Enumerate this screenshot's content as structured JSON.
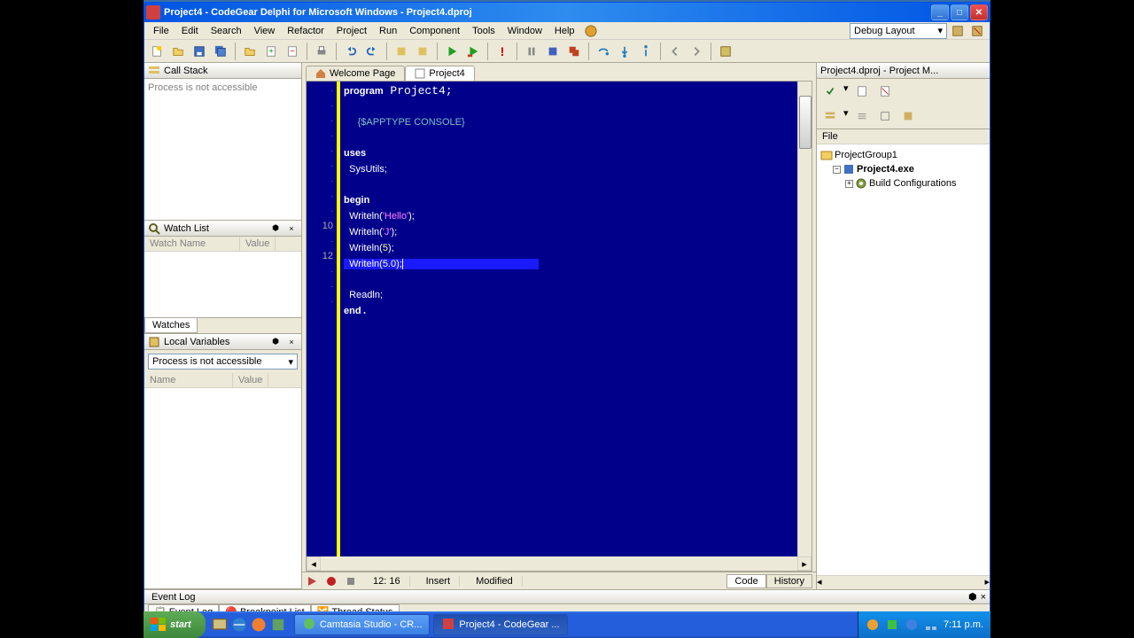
{
  "titlebar": "Project4 - CodeGear Delphi for Microsoft Windows - Project4.dproj",
  "menu": [
    "File",
    "Edit",
    "Search",
    "View",
    "Refactor",
    "Project",
    "Run",
    "Component",
    "Tools",
    "Window",
    "Help"
  ],
  "layout_combo": "Debug Layout",
  "panels": {
    "callstack": {
      "title": "Call Stack",
      "body": "Process is not accessible"
    },
    "watchlist": {
      "title": "Watch List",
      "cols": [
        "Watch Name",
        "Value"
      ],
      "tab": "Watches"
    },
    "localvars": {
      "title": "Local Variables",
      "combo": "Process is not accessible",
      "cols": [
        "Name",
        "Value"
      ]
    },
    "eventlog": {
      "title": "Event Log"
    }
  },
  "editor_tabs": {
    "welcome": "Welcome Page",
    "active": "Project4"
  },
  "code": {
    "l1": "program Project4;",
    "l3": "{$APPTYPE CONSOLE}",
    "l5": "uses",
    "l6": "  SysUtils;",
    "l8": "begin",
    "l9a": "  Writeln(",
    "l9b": "'Hello'",
    "l9c": ");",
    "l10a": "  Writeln(",
    "l10b": "'J'",
    "l10c": ");",
    "l11a": "  Writeln(",
    "l11b": "5",
    "l11c": ");",
    "l12a": "  Writeln(",
    "l12b": "5.0",
    "l12c": ");",
    "l14": "  Readln;",
    "l15": "end."
  },
  "line_numbers": {
    "ten": "10",
    "twelve": "12"
  },
  "status": {
    "pos": "12: 16",
    "mode": "Insert",
    "state": "Modified",
    "code_tab": "Code",
    "history_tab": "History"
  },
  "project_manager": {
    "title": "Project4.dproj - Project M...",
    "col": "File",
    "group": "ProjectGroup1",
    "exe": "Project4.exe",
    "build": "Build Configurations"
  },
  "bottom_tabs": [
    "Event Log",
    "Breakpoint List",
    "Thread Status"
  ],
  "taskbar": {
    "start": "start",
    "tasks": [
      "Camtasia Studio - CR...",
      "Project4 - CodeGear ..."
    ],
    "time": "7:11 p.m."
  }
}
